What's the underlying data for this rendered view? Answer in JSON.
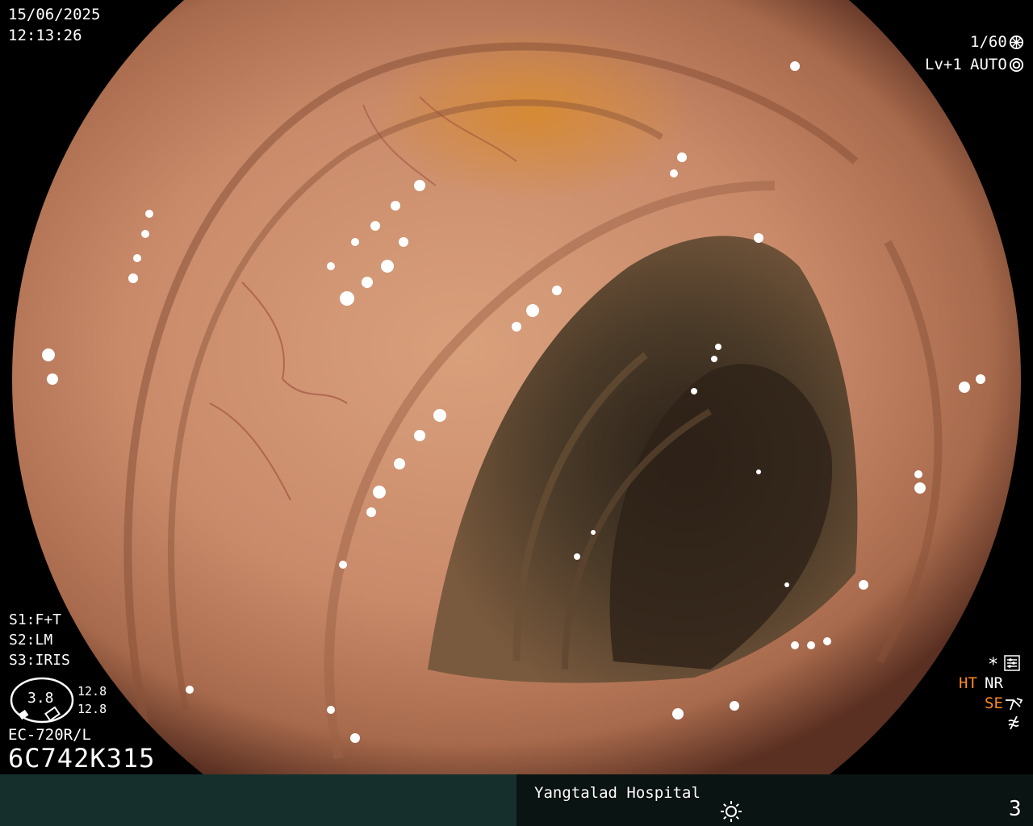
{
  "overlay": {
    "date": "15/06/2025",
    "time": "12:13:26",
    "shutter": "1/60",
    "level": "Lv+1",
    "iris_mode": "AUTO",
    "s1": "S1:F+T",
    "s2": "S2:LM",
    "s3": "S3:IRIS",
    "gauge_value": "3.8",
    "gauge_upper": "12.8",
    "gauge_lower": "12.8",
    "scope_model": "EC-720R/L",
    "serial": "6C742K315",
    "mode_ht": "HT",
    "mode_nr": "NR",
    "mode_se": "SE"
  },
  "footer": {
    "hospital": "Yangtalad Hospital",
    "page": "3"
  },
  "colors": {
    "accent_orange": "#ff8a1e",
    "footer_bg": "#0f2320",
    "mucosa": "#c98a6a"
  },
  "icons": {
    "shutter": "aperture-icon",
    "iris": "iris-icon",
    "settings": "settings-panel-icon",
    "structure": "structure-enhance-icon",
    "light": "light-sun-icon"
  }
}
